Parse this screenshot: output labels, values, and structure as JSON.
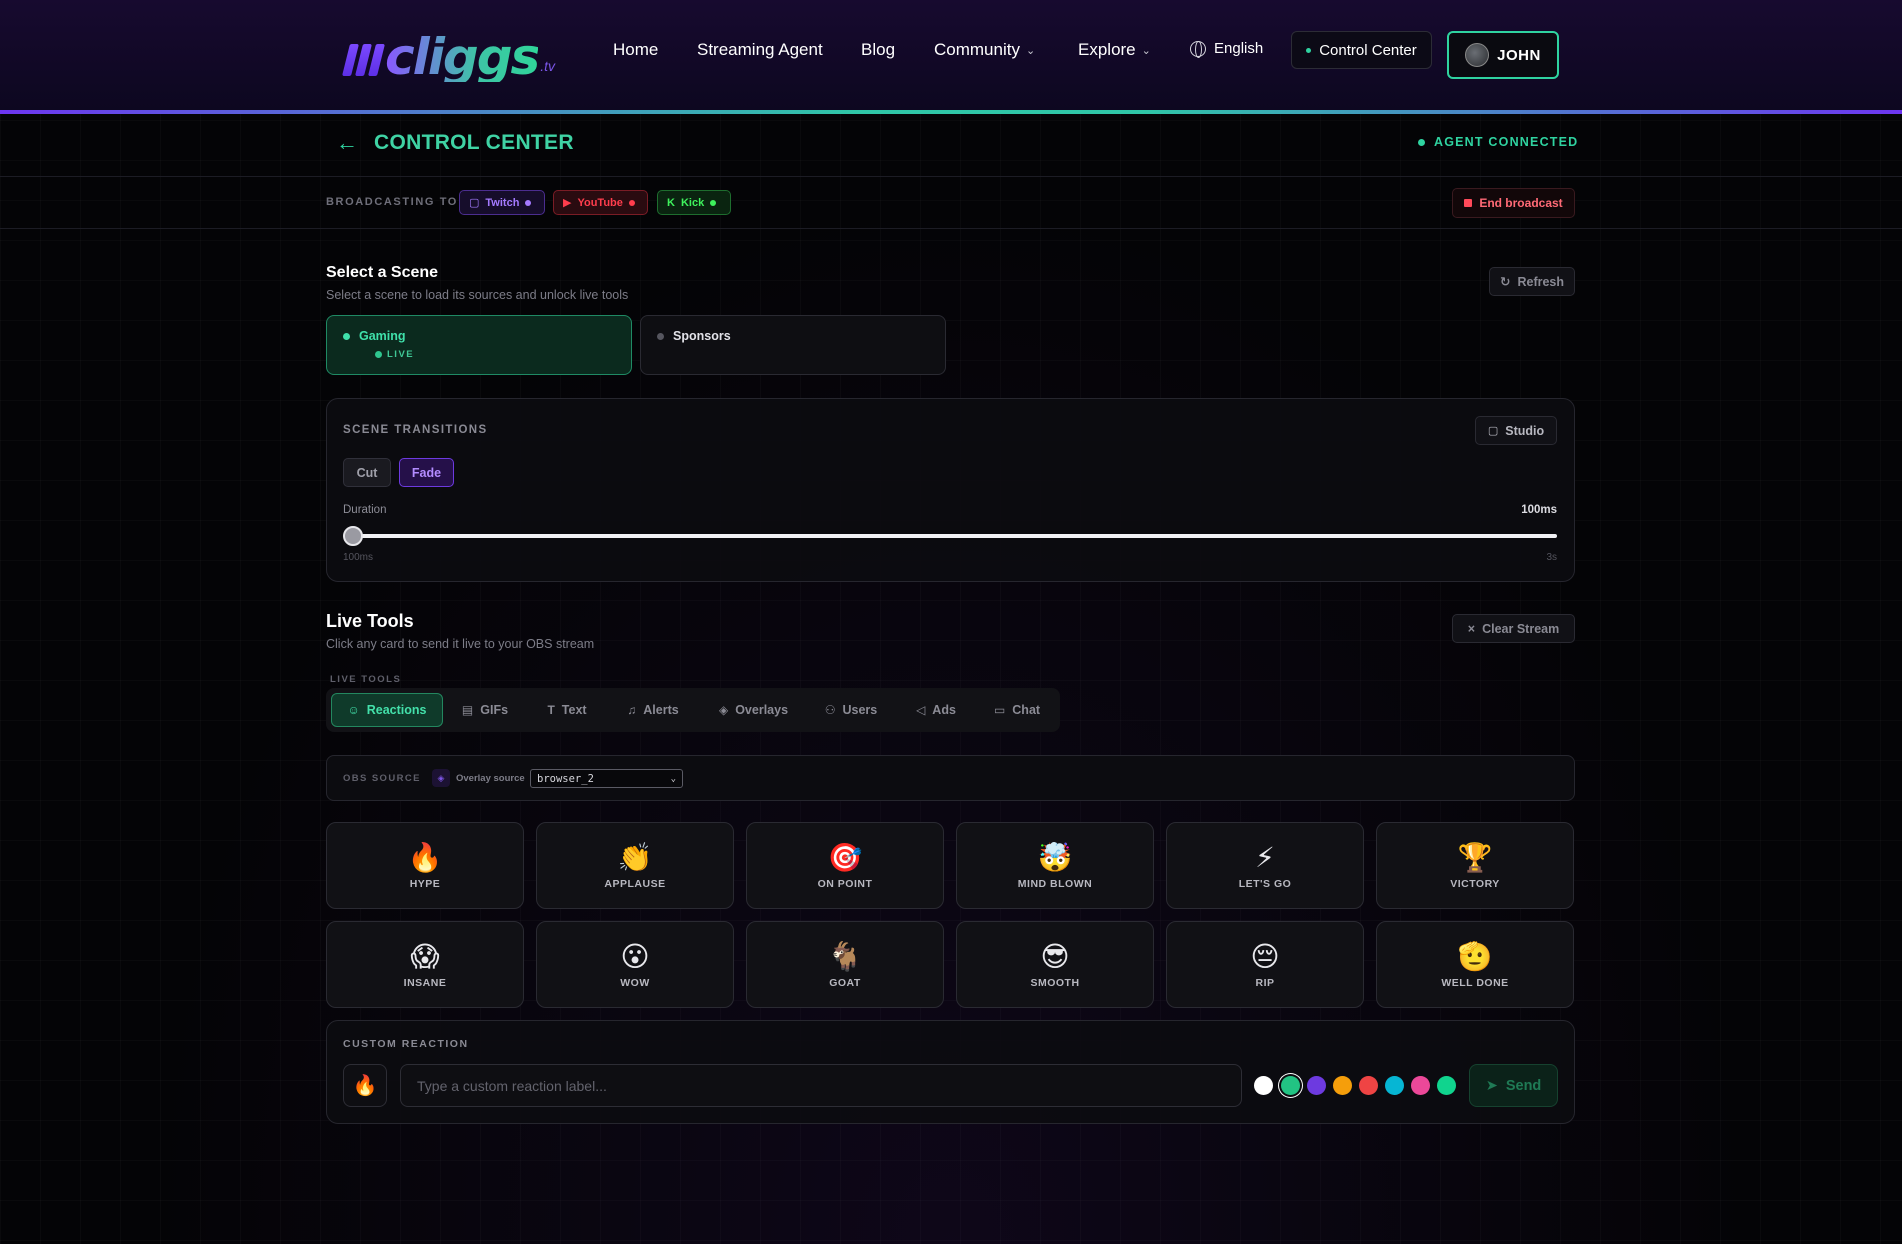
{
  "nav": {
    "logo_text": "cliggs",
    "logo_suffix": ".tv",
    "links": [
      {
        "label": "Home"
      },
      {
        "label": "Streaming Agent"
      },
      {
        "label": "Blog"
      },
      {
        "label": "Community"
      },
      {
        "label": "Explore"
      }
    ],
    "language": "English",
    "control_center": "Control Center",
    "user": "JOHN"
  },
  "header": {
    "back_icon": "arrow-left-icon",
    "title": "CONTROL CENTER",
    "status": "AGENT CONNECTED"
  },
  "broadcast": {
    "label": "BROADCASTING TO",
    "platforms": [
      {
        "name": "Twitch",
        "color": "#a47aff"
      },
      {
        "name": "YouTube",
        "color": "#ff3d4d"
      },
      {
        "name": "Kick",
        "color": "#3ef15c"
      }
    ],
    "end_label": "End broadcast"
  },
  "scenes": {
    "title": "Select a Scene",
    "subtitle": "Select a scene to load its sources and unlock live tools",
    "refresh_label": "Refresh",
    "items": [
      {
        "name": "Gaming",
        "status": "LIVE"
      },
      {
        "name": "Sponsors"
      }
    ]
  },
  "transitions": {
    "label": "SCENE TRANSITIONS",
    "studio_label": "Studio",
    "options": [
      "Cut",
      "Fade"
    ],
    "selected": "Fade",
    "duration_label": "Duration",
    "duration_value": "100ms",
    "min_label": "100ms",
    "max_label": "3s",
    "slider_fraction": 0
  },
  "live_tools": {
    "title": "Live Tools",
    "subtitle": "Click any card to send it live to your OBS stream",
    "clear_label": "Clear Stream",
    "tabs_label": "LIVE TOOLS",
    "tabs": [
      {
        "label": "Reactions",
        "icon": "smile-icon"
      },
      {
        "label": "GIFs",
        "icon": "film-icon"
      },
      {
        "label": "Text",
        "icon": "text-icon"
      },
      {
        "label": "Alerts",
        "icon": "bell-icon"
      },
      {
        "label": "Overlays",
        "icon": "layers-icon"
      },
      {
        "label": "Users",
        "icon": "users-icon"
      },
      {
        "label": "Ads",
        "icon": "megaphone-icon"
      },
      {
        "label": "Chat",
        "icon": "chat-icon"
      }
    ],
    "active_tab": "Reactions"
  },
  "obs": {
    "label": "OBS SOURCE",
    "source_label": "Overlay source",
    "selected_source": "browser_2"
  },
  "reactions": [
    {
      "emoji": "🔥",
      "label": "HYPE"
    },
    {
      "emoji": "👏",
      "label": "APPLAUSE"
    },
    {
      "emoji": "🎯",
      "label": "ON POINT"
    },
    {
      "emoji": "🤯",
      "label": "MIND BLOWN"
    },
    {
      "emoji": "⚡",
      "label": "LET'S GO"
    },
    {
      "emoji": "🏆",
      "label": "VICTORY"
    },
    {
      "emoji": "😱",
      "label": "INSANE"
    },
    {
      "emoji": "😮",
      "label": "WOW"
    },
    {
      "emoji": "🐐",
      "label": "GOAT"
    },
    {
      "emoji": "😎",
      "label": "SMOOTH"
    },
    {
      "emoji": "😔",
      "label": "RIP"
    },
    {
      "emoji": "🫡",
      "label": "WELL DONE"
    }
  ],
  "custom_reaction": {
    "label": "CUSTOM REACTION",
    "emoji": "🔥",
    "placeholder": "Type a custom reaction label...",
    "colors": [
      "#ffffff",
      "#22c383",
      "#6d3ae0",
      "#f59e0b",
      "#ef4444",
      "#06b6d4",
      "#ec4899",
      "#10d48e"
    ],
    "selected_color": "#22c383",
    "send_label": "Send"
  }
}
